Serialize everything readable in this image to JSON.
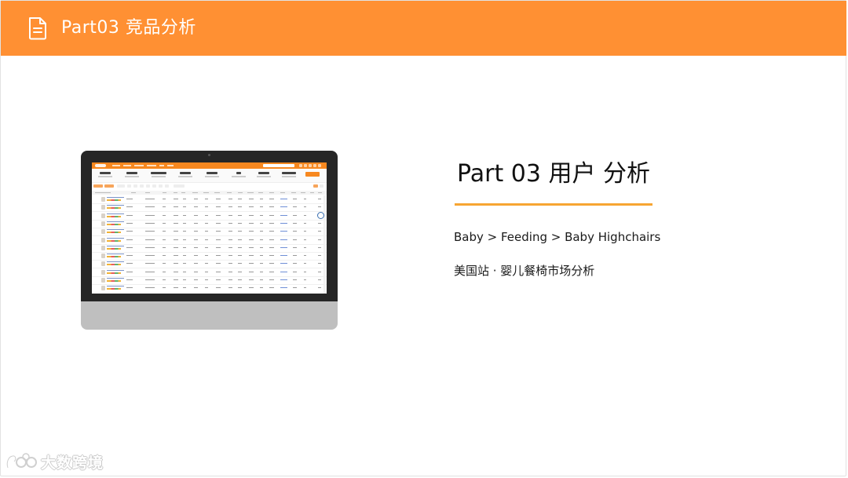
{
  "header": {
    "title": "Part03 竞品分析",
    "icon": "document-icon",
    "background_color": "#ff9033"
  },
  "monitor": {
    "icon": "monitor-screenshot",
    "screen_accent_color": "#f7881f"
  },
  "section": {
    "title": "Part 03  用户 分析",
    "divider_color": "#f7a532",
    "breadcrumb": "Baby > Feeding > Baby Highchairs",
    "subtitle": "美国站 · 婴儿餐椅市场分析"
  },
  "footer": {
    "logo_icon": "dashu-logo-icon",
    "brand": "大数跨境"
  }
}
